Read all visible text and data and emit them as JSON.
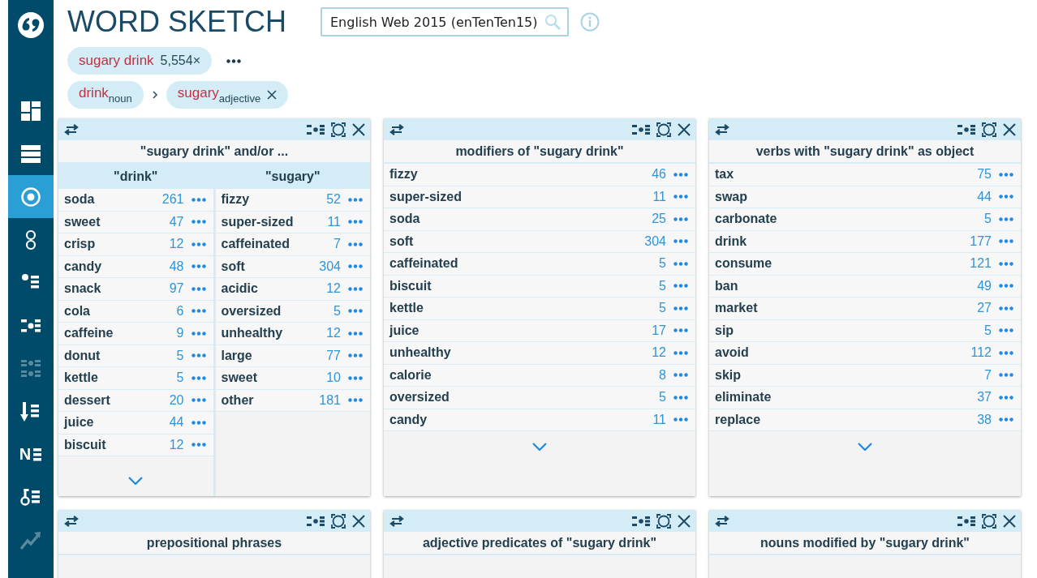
{
  "sidebar": {
    "items": [
      {
        "kind": "dashboard",
        "selected": false,
        "disabled": false
      },
      {
        "kind": "list",
        "selected": false,
        "disabled": false
      },
      {
        "kind": "target",
        "selected": true,
        "disabled": false
      },
      {
        "kind": "rings",
        "selected": false,
        "disabled": false
      },
      {
        "kind": "dotlist",
        "selected": false,
        "disabled": false
      },
      {
        "kind": "dotgrid",
        "selected": false,
        "disabled": false
      },
      {
        "kind": "dotgrid2",
        "selected": false,
        "disabled": true
      },
      {
        "kind": "sortlist",
        "selected": false,
        "disabled": false
      },
      {
        "kind": "nlist",
        "glyph": "N",
        "selected": false,
        "disabled": false
      },
      {
        "kind": "keylist",
        "selected": false,
        "disabled": false
      },
      {
        "kind": "trend",
        "selected": false,
        "disabled": true
      }
    ]
  },
  "header": {
    "title": "WORD SKETCH",
    "corpus": "English Web 2015 (enTenTen15)"
  },
  "query": {
    "phrase": "sugary drink",
    "count": "5,554×"
  },
  "breadcrumb": [
    {
      "word": "drink",
      "pos": "noun",
      "removable": false
    },
    {
      "word": "sugary",
      "pos": "adjective",
      "removable": true
    }
  ],
  "panels": [
    {
      "title": "\"sugary drink\" and/or ...",
      "columns": [
        {
          "heading": "\"drink\"",
          "rows": [
            {
              "word": "soda",
              "count": "261"
            },
            {
              "word": "sweet",
              "count": "47"
            },
            {
              "word": "crisp",
              "count": "12"
            },
            {
              "word": "candy",
              "count": "48"
            },
            {
              "word": "snack",
              "count": "97"
            },
            {
              "word": "cola",
              "count": "6"
            },
            {
              "word": "caffeine",
              "count": "9"
            },
            {
              "word": "donut",
              "count": "5"
            },
            {
              "word": "kettle",
              "count": "5"
            },
            {
              "word": "dessert",
              "count": "20"
            },
            {
              "word": "juice",
              "count": "44"
            },
            {
              "word": "biscuit",
              "count": "12"
            }
          ]
        },
        {
          "heading": "\"sugary\"",
          "rows": [
            {
              "word": "fizzy",
              "count": "52"
            },
            {
              "word": "super-sized",
              "count": "11"
            },
            {
              "word": "caffeinated",
              "count": "7"
            },
            {
              "word": "soft",
              "count": "304"
            },
            {
              "word": "acidic",
              "count": "12"
            },
            {
              "word": "oversized",
              "count": "5"
            },
            {
              "word": "unhealthy",
              "count": "12"
            },
            {
              "word": "large",
              "count": "77"
            },
            {
              "word": "sweet",
              "count": "10"
            },
            {
              "word": "other",
              "count": "181"
            }
          ]
        }
      ]
    },
    {
      "title": "modifiers of \"sugary drink\"",
      "columns": [
        {
          "rows": [
            {
              "word": "fizzy",
              "count": "46"
            },
            {
              "word": "super-sized",
              "count": "11"
            },
            {
              "word": "soda",
              "count": "25"
            },
            {
              "word": "soft",
              "count": "304"
            },
            {
              "word": "caffeinated",
              "count": "5"
            },
            {
              "word": "biscuit",
              "count": "5"
            },
            {
              "word": "kettle",
              "count": "5"
            },
            {
              "word": "juice",
              "count": "17"
            },
            {
              "word": "unhealthy",
              "count": "12"
            },
            {
              "word": "calorie",
              "count": "8"
            },
            {
              "word": "oversized",
              "count": "5"
            },
            {
              "word": "candy",
              "count": "11"
            }
          ]
        }
      ]
    },
    {
      "title": "verbs with \"sugary drink\" as object",
      "columns": [
        {
          "rows": [
            {
              "word": "tax",
              "count": "75"
            },
            {
              "word": "swap",
              "count": "44"
            },
            {
              "word": "carbonate",
              "count": "5"
            },
            {
              "word": "drink",
              "count": "177"
            },
            {
              "word": "consume",
              "count": "121"
            },
            {
              "word": "ban",
              "count": "49"
            },
            {
              "word": "market",
              "count": "27"
            },
            {
              "word": "sip",
              "count": "5"
            },
            {
              "word": "avoid",
              "count": "112"
            },
            {
              "word": "skip",
              "count": "7"
            },
            {
              "word": "eliminate",
              "count": "37"
            },
            {
              "word": "replace",
              "count": "38"
            }
          ]
        }
      ]
    },
    {
      "title": "prepositional phrases"
    },
    {
      "title": "adjective predicates of \"sugary drink\""
    },
    {
      "title": "nouns modified by \"sugary drink\""
    }
  ]
}
